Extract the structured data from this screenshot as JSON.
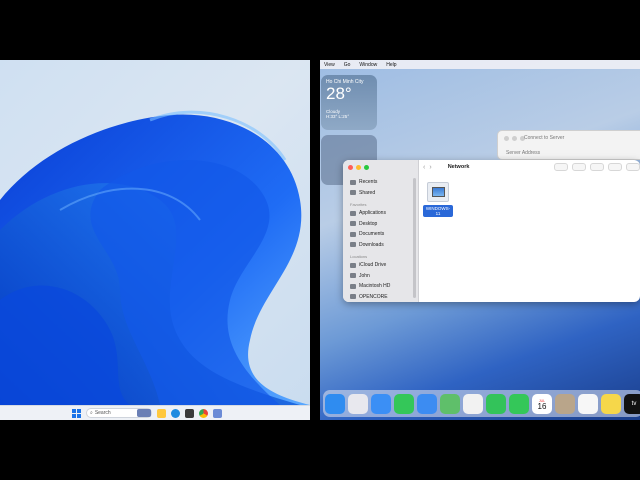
{
  "windows": {
    "taskbar": {
      "search_placeholder": "Search"
    }
  },
  "mac": {
    "menubar": {
      "items": [
        "View",
        "Go",
        "Window",
        "Help"
      ]
    },
    "weather": {
      "city": "Ho Chi Minh City",
      "temp": "28°",
      "condition": "Cloudy",
      "high_low": "H:33° L:25°"
    },
    "connect_dialog": {
      "title": "Connect to Server",
      "field_label": "Server Address"
    },
    "finder": {
      "title": "Network",
      "sidebar": [
        {
          "type": "item",
          "label": "Recents",
          "icon": "clock-icon"
        },
        {
          "type": "item",
          "label": "Shared",
          "icon": "shared-folder-icon"
        },
        {
          "type": "header",
          "label": "Favorites"
        },
        {
          "type": "item",
          "label": "Applications",
          "icon": "applications-icon"
        },
        {
          "type": "item",
          "label": "Desktop",
          "icon": "desktop-icon"
        },
        {
          "type": "item",
          "label": "Documents",
          "icon": "document-icon"
        },
        {
          "type": "item",
          "label": "Downloads",
          "icon": "download-icon"
        },
        {
          "type": "header",
          "label": "Locations"
        },
        {
          "type": "item",
          "label": "iCloud Drive",
          "icon": "cloud-icon"
        },
        {
          "type": "item",
          "label": "John",
          "icon": "home-icon"
        },
        {
          "type": "item",
          "label": "Macintosh HD",
          "icon": "disk-icon"
        },
        {
          "type": "item",
          "label": "OPENCORE",
          "icon": "disk-icon"
        }
      ],
      "items": [
        {
          "label": "WINDOWS-11",
          "icon": "computer-icon"
        }
      ]
    },
    "dock": {
      "calendar": {
        "month": "JUL",
        "day": "16"
      },
      "tv_label": "tv",
      "apps": [
        {
          "name": "finder-icon",
          "color": "#2f8cf0"
        },
        {
          "name": "launchpad-icon",
          "color": "#e8e8ee"
        },
        {
          "name": "safari-icon",
          "color": "#3b8ff5"
        },
        {
          "name": "messages-icon",
          "color": "#34c759"
        },
        {
          "name": "mail-icon",
          "color": "#3c8cf2"
        },
        {
          "name": "maps-icon",
          "color": "#5fbf6a"
        },
        {
          "name": "photos-icon",
          "color": "#f2f2f2"
        },
        {
          "name": "facetime-icon",
          "color": "#33c35a"
        },
        {
          "name": "phone-icon",
          "color": "#34c759"
        },
        {
          "name": "calendar-icon",
          "color": "#ffffff"
        },
        {
          "name": "contacts-icon",
          "color": "#b9a58a"
        },
        {
          "name": "reminders-icon",
          "color": "#f7f7f7"
        },
        {
          "name": "notes-icon",
          "color": "#f6d74a"
        },
        {
          "name": "tv-icon",
          "color": "#111111"
        },
        {
          "name": "news-icon",
          "color": "#f0405a"
        }
      ]
    }
  }
}
